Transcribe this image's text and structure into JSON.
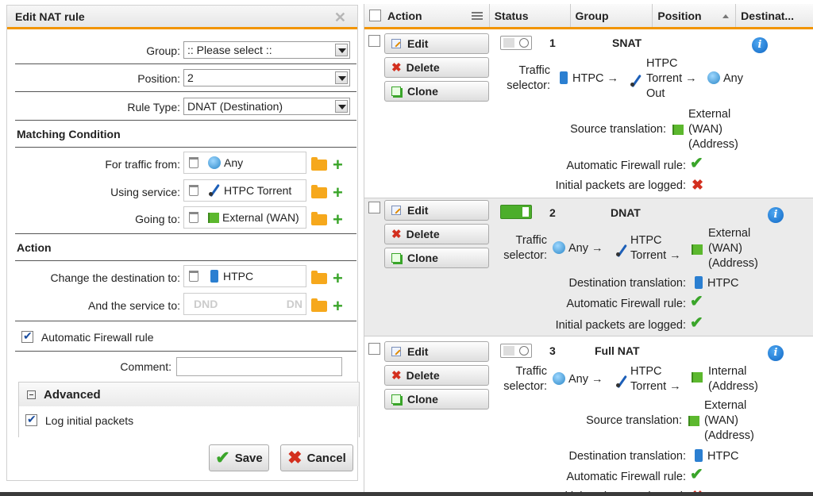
{
  "dialog": {
    "title": "Edit NAT rule",
    "close_symbol": "✕",
    "group_label": "Group:",
    "group_value": ":: Please select ::",
    "position_label": "Position:",
    "position_value": "2",
    "rule_type_label": "Rule Type:",
    "rule_type_value": "DNAT (Destination)",
    "matching_title": "Matching Condition",
    "traffic_from_label": "For traffic from:",
    "traffic_from_value": "Any",
    "using_service_label": "Using service:",
    "using_service_value": "HTPC Torrent",
    "going_to_label": "Going to:",
    "going_to_value": "External (WAN)",
    "action_title": "Action",
    "change_dest_label": "Change the destination to:",
    "change_dest_value": "HTPC",
    "service_to_label": "And the service to:",
    "service_to_placeholder": "DND",
    "service_to_placeholder_right": "DN",
    "auto_firewall_label": "Automatic Firewall rule",
    "auto_firewall_checked": true,
    "comment_label": "Comment:",
    "comment_value": "",
    "advanced_title": "Advanced",
    "log_packets_label": "Log initial packets",
    "log_packets_checked": true,
    "save_label": "Save",
    "cancel_label": "Cancel"
  },
  "table": {
    "columns": [
      "Action",
      "Status",
      "Group",
      "Position",
      "Destinat..."
    ],
    "rules": [
      {
        "number": "1",
        "type": "SNAT",
        "enabled": false,
        "edit_label": "Edit",
        "delete_label": "Delete",
        "clone_label": "Clone",
        "selector_label_1": "Traffic",
        "selector_label_2": "selector:",
        "src": "HTPC",
        "service_1": "HTPC",
        "service_2": "Torrent",
        "service_3": "Out",
        "dst": "Any",
        "arrow": "→",
        "translation_label": "Source translation:",
        "translation_1": "External",
        "translation_2": "(WAN)",
        "translation_3": "(Address)",
        "firewall_label": "Automatic Firewall rule:",
        "logged_label": "Initial packets are logged:",
        "firewall_on": true,
        "logged_on": false
      },
      {
        "number": "2",
        "type": "DNAT",
        "enabled": true,
        "edit_label": "Edit",
        "delete_label": "Delete",
        "clone_label": "Clone",
        "selector_label_1": "Traffic",
        "selector_label_2": "selector:",
        "src": "Any",
        "service_1": "HTPC",
        "service_2": "Torrent",
        "dst_1": "External",
        "dst_2": "(WAN)",
        "dst_3": "(Address)",
        "arrow": "→",
        "translation_label": "Destination translation:",
        "translation": "HTPC",
        "firewall_label": "Automatic Firewall rule:",
        "logged_label": "Initial packets are logged:",
        "firewall_on": true,
        "logged_on": true
      },
      {
        "number": "3",
        "type": "Full NAT",
        "enabled": false,
        "edit_label": "Edit",
        "delete_label": "Delete",
        "clone_label": "Clone",
        "selector_label_1": "Traffic",
        "selector_label_2": "selector:",
        "src": "Any",
        "service_1": "HTPC",
        "service_2": "Torrent",
        "dst_1": "Internal",
        "dst_2": "(Address)",
        "arrow": "→",
        "src_translation_label": "Source translation:",
        "src_translation_1": "External",
        "src_translation_2": "(WAN)",
        "src_translation_3": "(Address)",
        "dest_translation_label": "Destination translation:",
        "dest_translation": "HTPC",
        "firewall_label": "Automatic Firewall rule:",
        "logged_label": "Initial packets are logged:",
        "firewall_on": true,
        "logged_on": false
      }
    ]
  },
  "symbols": {
    "tick": "✔",
    "cross": "✖",
    "plus": "+",
    "info": "i",
    "delete_x": "✖"
  }
}
